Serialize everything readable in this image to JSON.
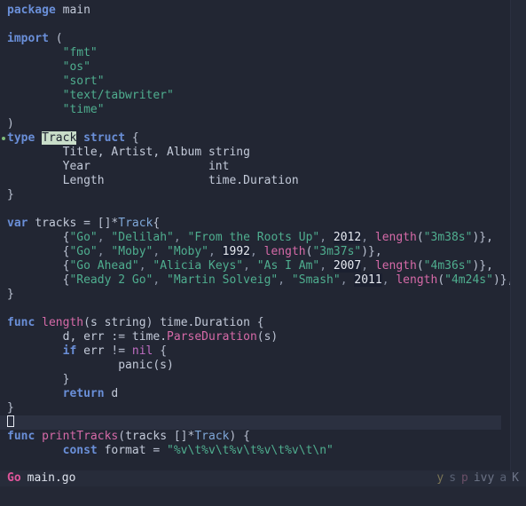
{
  "app": {
    "kind": "terminal-text-editor",
    "language": "Go"
  },
  "colors": {
    "editor_background": "#222633",
    "statusline_background": "#272c3a",
    "cursorline_background": "#2b3040",
    "keyword": "#6a8fd8",
    "string": "#4fae8f",
    "function": "#d66aa8",
    "type": "#7fa7d8",
    "text": "#c8cede",
    "search_highlight_bg": "#c9ddc9",
    "sign_dot": "#7fba7a",
    "filetype_badge": "#e0559b"
  },
  "editor": {
    "cursor": {
      "shape": "hollow-block",
      "line_index": 30,
      "column": 0
    },
    "search_term": "Track",
    "sign_marker_line_index": 9,
    "lines": [
      {
        "i": 0,
        "text": "package main"
      },
      {
        "i": 1,
        "text": ""
      },
      {
        "i": 2,
        "text": "import ("
      },
      {
        "i": 3,
        "text": "        \"fmt\""
      },
      {
        "i": 4,
        "text": "        \"os\""
      },
      {
        "i": 5,
        "text": "        \"sort\""
      },
      {
        "i": 6,
        "text": "        \"text/tabwriter\""
      },
      {
        "i": 7,
        "text": "        \"time\""
      },
      {
        "i": 8,
        "text": ")"
      },
      {
        "i": 9,
        "text": "type Track struct {"
      },
      {
        "i": 10,
        "text": "        Title, Artist, Album string"
      },
      {
        "i": 11,
        "text": "        Year                 int"
      },
      {
        "i": 12,
        "text": "        Length               time.Duration"
      },
      {
        "i": 13,
        "text": "}"
      },
      {
        "i": 14,
        "text": ""
      },
      {
        "i": 15,
        "text": "var tracks = []*Track{"
      },
      {
        "i": 16,
        "text": "        {\"Go\", \"Delilah\", \"From the Roots Up\", 2012, length(\"3m38s\")},"
      },
      {
        "i": 17,
        "text": "        {\"Go\", \"Moby\", \"Moby\", 1992, length(\"3m37s\")},"
      },
      {
        "i": 18,
        "text": "        {\"Go Ahead\", \"Alicia Keys\", \"As I Am\", 2007, length(\"4m36s\")},"
      },
      {
        "i": 19,
        "text": "        {\"Ready 2 Go\", \"Martin Solveig\", \"Smash\", 2011, length(\"4m24s\")},"
      },
      {
        "i": 20,
        "text": "}"
      },
      {
        "i": 21,
        "text": ""
      },
      {
        "i": 22,
        "text": "func length(s string) time.Duration {"
      },
      {
        "i": 23,
        "text": "        d, err := time.ParseDuration(s)"
      },
      {
        "i": 24,
        "text": "        if err != nil {"
      },
      {
        "i": 25,
        "text": "                panic(s)"
      },
      {
        "i": 26,
        "text": "        }"
      },
      {
        "i": 27,
        "text": "        return d"
      },
      {
        "i": 28,
        "text": "}"
      },
      {
        "i": 29,
        "text": ""
      },
      {
        "i": 30,
        "text": "func printTracks(tracks []*Track) {"
      },
      {
        "i": 31,
        "text": "        const format = \"%v\\t%v\\t%v\\t%v\\t%v\\t\\n\""
      }
    ],
    "tracks_data": [
      {
        "title": "Go",
        "artist": "Delilah",
        "album": "From the Roots Up",
        "year": 2012,
        "length": "3m38s"
      },
      {
        "title": "Go",
        "artist": "Moby",
        "album": "Moby",
        "year": 1992,
        "length": "3m37s"
      },
      {
        "title": "Go Ahead",
        "artist": "Alicia Keys",
        "album": "As I Am",
        "year": 2007,
        "length": "4m36s"
      },
      {
        "title": "Ready 2 Go",
        "artist": "Martin Solveig",
        "album": "Smash",
        "year": 2011,
        "length": "4m24s"
      }
    ]
  },
  "statusline": {
    "filetype": "Go",
    "filename": "main.go",
    "indicators": [
      {
        "key": "y",
        "label": "y"
      },
      {
        "key": "s",
        "label": "s"
      },
      {
        "key": "p",
        "label": "p"
      },
      {
        "key": "ivy",
        "label": "ivy"
      },
      {
        "key": "a",
        "label": "a"
      },
      {
        "key": "K",
        "label": "K"
      }
    ]
  },
  "cmdline": {
    "text": ""
  }
}
